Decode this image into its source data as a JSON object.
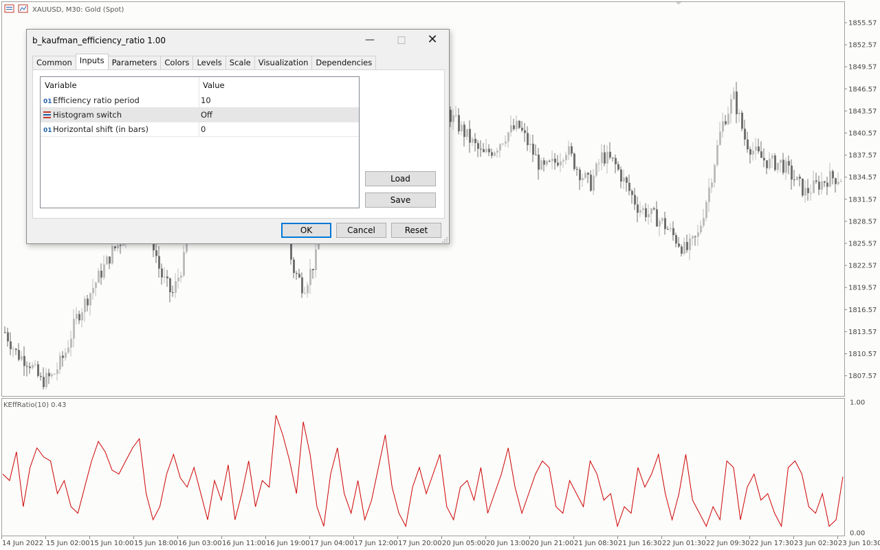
{
  "chart_header": {
    "symbol_text": "XAUUSD, M30:  Gold (Spot)"
  },
  "indicator_legend": "KEffRatio(10) 0.43",
  "price_axis": [
    "1855.57",
    "1852.57",
    "1849.57",
    "1846.57",
    "1843.57",
    "1840.57",
    "1837.57",
    "1834.57",
    "1831.57",
    "1828.57",
    "1825.57",
    "1822.57",
    "1819.57",
    "1816.57",
    "1813.57",
    "1810.57",
    "1807.57"
  ],
  "indicator_axis": [
    "1.00",
    "0.00"
  ],
  "time_axis": [
    "14 Jun 2022",
    "15 Jun 02:00",
    "15 Jun 10:00",
    "15 Jun 18:00",
    "16 Jun 03:00",
    "16 Jun 11:00",
    "16 Jun 19:00",
    "17 Jun 04:00",
    "17 Jun 12:00",
    "17 Jun 20:00",
    "20 Jun 05:00",
    "20 Jun 13:00",
    "20 Jun 21:00",
    "21 Jun 08:30",
    "21 Jun 16:30",
    "22 Jun 01:30",
    "22 Jun 09:30",
    "22 Jun 17:30",
    "23 Jun 02:30",
    "23 Jun 10:30"
  ],
  "colors": {
    "indicator_line": "#cc0000",
    "candle_dark": "#707070",
    "candle_light": "#bdbdbd",
    "accent": "#0078d7"
  },
  "chart_data": [
    {
      "type": "candlestick",
      "title": "XAUUSD, M30:  Gold (Spot)",
      "ylim": [
        1805.5,
        1858.5
      ],
      "close_path": [
        1813.5,
        1810.5,
        1809.5,
        1806.8,
        1807.5,
        1810.5,
        1815.5,
        1818.5,
        1821.5,
        1824.5,
        1826.5,
        1829.5,
        1828.5,
        1821.5,
        1818.5,
        1823.5,
        1840.5,
        1843.5,
        1852.5,
        1852.5,
        1847.5,
        1845.5,
        1847.5,
        1840.5,
        1822.5,
        1819.5,
        1823.5,
        1831.5,
        1833.5,
        1830.5,
        1837.5,
        1838.5,
        1849.5,
        1851.5,
        1850.5,
        1846.5,
        1843.5,
        1843.5,
        1841.5,
        1839.5,
        1837.5,
        1838.5,
        1840.5,
        1841.5,
        1838.5,
        1835.5,
        1836.5,
        1838.5,
        1835.5,
        1833.5,
        1837.5,
        1836.5,
        1833.5,
        1830.5,
        1829.5,
        1828.5,
        1826.5,
        1824.5,
        1826.5,
        1833.5,
        1841.5,
        1845.5,
        1839.5,
        1837.5,
        1836.5,
        1836.5,
        1834.5,
        1832.5,
        1833.5,
        1834.5,
        1834.5
      ]
    },
    {
      "type": "line",
      "title": "KEffRatio(10) 0.43",
      "ylim": [
        0,
        1
      ],
      "values": [
        0.45,
        0.4,
        0.62,
        0.2,
        0.5,
        0.65,
        0.58,
        0.55,
        0.3,
        0.4,
        0.2,
        0.15,
        0.35,
        0.55,
        0.7,
        0.62,
        0.48,
        0.45,
        0.55,
        0.65,
        0.72,
        0.3,
        0.1,
        0.2,
        0.45,
        0.6,
        0.42,
        0.35,
        0.5,
        0.3,
        0.1,
        0.4,
        0.25,
        0.52,
        0.1,
        0.3,
        0.55,
        0.2,
        0.4,
        0.35,
        0.9,
        0.75,
        0.55,
        0.3,
        0.85,
        0.6,
        0.2,
        0.05,
        0.45,
        0.65,
        0.3,
        0.15,
        0.4,
        0.1,
        0.25,
        0.5,
        0.75,
        0.35,
        0.15,
        0.05,
        0.35,
        0.5,
        0.3,
        0.45,
        0.6,
        0.2,
        0.1,
        0.35,
        0.4,
        0.25,
        0.5,
        0.15,
        0.3,
        0.45,
        0.65,
        0.35,
        0.15,
        0.3,
        0.45,
        0.55,
        0.5,
        0.2,
        0.15,
        0.4,
        0.3,
        0.2,
        0.55,
        0.45,
        0.25,
        0.3,
        0.05,
        0.2,
        0.15,
        0.5,
        0.35,
        0.45,
        0.6,
        0.3,
        0.1,
        0.3,
        0.6,
        0.25,
        0.15,
        0.05,
        0.2,
        0.1,
        0.55,
        0.5,
        0.1,
        0.35,
        0.45,
        0.25,
        0.3,
        0.15,
        0.05,
        0.5,
        0.55,
        0.45,
        0.2,
        0.15,
        0.3,
        0.05,
        0.1,
        0.43
      ]
    }
  ],
  "dialog": {
    "title": "b_kaufman_efficiency_ratio 1.00",
    "tabs": [
      "Common",
      "Inputs",
      "Parameters",
      "Colors",
      "Levels",
      "Scale",
      "Visualization",
      "Dependencies"
    ],
    "active_tab": "Inputs",
    "columns": {
      "variable": "Variable",
      "value": "Value"
    },
    "rows": [
      {
        "type_icon": "01",
        "variable": "Efficiency ratio period",
        "value": "10"
      },
      {
        "type_icon": "enum-icon",
        "variable": "Histogram switch",
        "value": "Off"
      },
      {
        "type_icon": "01",
        "variable": "Horizontal shift (in bars)",
        "value": "0"
      }
    ],
    "buttons": {
      "load": "Load",
      "save": "Save",
      "ok": "OK",
      "cancel": "Cancel",
      "reset": "Reset"
    }
  }
}
